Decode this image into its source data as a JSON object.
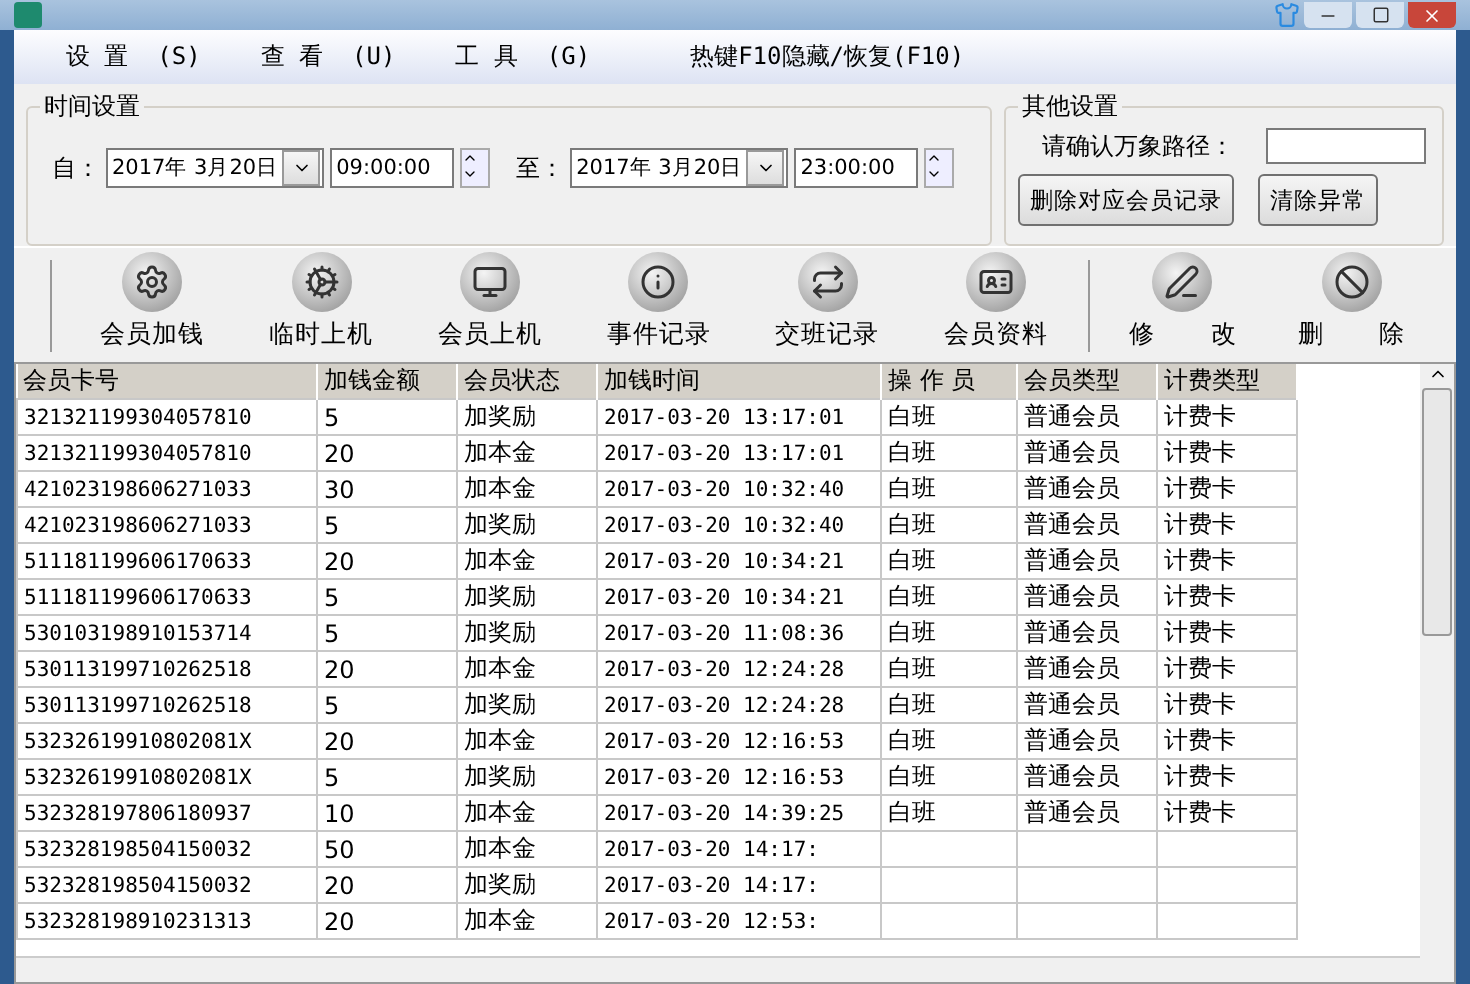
{
  "menu": [
    {
      "label": "设 置",
      "key": "(S)"
    },
    {
      "label": "查 看",
      "key": "(U)"
    },
    {
      "label": "工 具",
      "key": "(G)"
    }
  ],
  "hotkey_hint": "热键F10隐藏/恢复(F10)",
  "time_settings": {
    "title": "时间设置",
    "from_label": "自：",
    "from_date": "2017年 3月20日",
    "from_time": "09:00:00",
    "to_label": "至：",
    "to_date": "2017年 3月20日",
    "to_time": "23:00:00"
  },
  "other_settings": {
    "title": "其他设置",
    "path_label": "请确认万象路径：",
    "buttons": [
      "删除对应会员记录",
      "清除异常"
    ]
  },
  "toolbar": [
    {
      "label": "会员加钱",
      "kind": "gear"
    },
    {
      "label": "临时上机",
      "kind": "gears"
    },
    {
      "label": "会员上机",
      "kind": "monitor"
    },
    {
      "label": "事件记录",
      "kind": "info"
    },
    {
      "label": "交班记录",
      "kind": "swap"
    },
    {
      "label": "会员资料",
      "kind": "card"
    },
    {
      "label": "修 改",
      "kind": "edit",
      "separated": true
    },
    {
      "label": "删 除",
      "kind": "ban"
    }
  ],
  "table": {
    "columns": [
      "会员卡号",
      "加钱金额",
      "会员状态",
      "加钱时间",
      "操 作 员",
      "会员类型",
      "计费类型"
    ],
    "rows": [
      [
        "321321199304057810",
        "5",
        "加奖励",
        "2017-03-20 13:17:01",
        "白班",
        "普通会员",
        "计费卡"
      ],
      [
        "321321199304057810",
        "20",
        "加本金",
        "2017-03-20 13:17:01",
        "白班",
        "普通会员",
        "计费卡"
      ],
      [
        "421023198606271033",
        "30",
        "加本金",
        "2017-03-20 10:32:40",
        "白班",
        "普通会员",
        "计费卡"
      ],
      [
        "421023198606271033",
        "5",
        "加奖励",
        "2017-03-20 10:32:40",
        "白班",
        "普通会员",
        "计费卡"
      ],
      [
        "511181199606170633",
        "20",
        "加本金",
        "2017-03-20 10:34:21",
        "白班",
        "普通会员",
        "计费卡"
      ],
      [
        "511181199606170633",
        "5",
        "加奖励",
        "2017-03-20 10:34:21",
        "白班",
        "普通会员",
        "计费卡"
      ],
      [
        "530103198910153714",
        "5",
        "加奖励",
        "2017-03-20 11:08:36",
        "白班",
        "普通会员",
        "计费卡"
      ],
      [
        "530113199710262518",
        "20",
        "加本金",
        "2017-03-20 12:24:28",
        "白班",
        "普通会员",
        "计费卡"
      ],
      [
        "530113199710262518",
        "5",
        "加奖励",
        "2017-03-20 12:24:28",
        "白班",
        "普通会员",
        "计费卡"
      ],
      [
        "53232619910802081X",
        "20",
        "加本金",
        "2017-03-20 12:16:53",
        "白班",
        "普通会员",
        "计费卡"
      ],
      [
        "53232619910802081X",
        "5",
        "加奖励",
        "2017-03-20 12:16:53",
        "白班",
        "普通会员",
        "计费卡"
      ],
      [
        "532328197806180937",
        "10",
        "加本金",
        "2017-03-20 14:39:25",
        "白班",
        "普通会员",
        "计费卡"
      ],
      [
        "532328198504150032",
        "50",
        "加本金",
        "2017-03-20 14:17:"
      ],
      [
        "532328198504150032",
        "20",
        "加奖励",
        "2017-03-20 14:17:"
      ],
      [
        "532328198910231313",
        "20",
        "加本金",
        "2017-03-20 12:53:"
      ]
    ]
  }
}
